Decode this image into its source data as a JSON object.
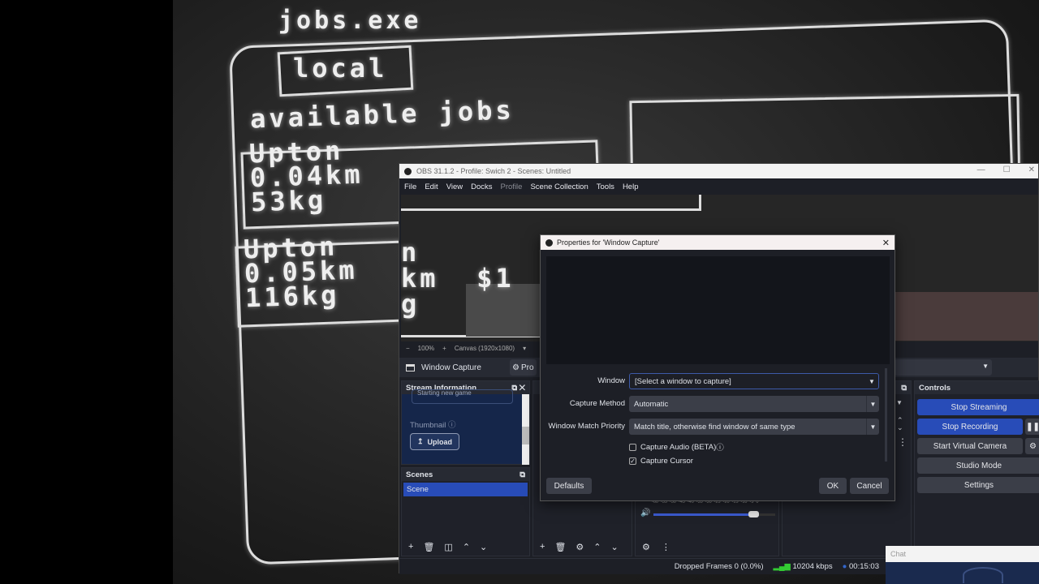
{
  "game": {
    "title": "jobs.exe",
    "tab": "local",
    "heading": "available jobs",
    "jobs": [
      {
        "name": "Upton",
        "distance": "0.04km",
        "weight": "53kg"
      },
      {
        "name": "Upton",
        "distance": "0.05km",
        "weight": "116kg"
      }
    ]
  },
  "obs": {
    "title": "OBS 31.1.2 - Profile: Swich 2 - Scenes: Untitled",
    "menu": [
      "File",
      "Edit",
      "View",
      "Docks",
      "Profile",
      "Scene Collection",
      "Tools",
      "Help"
    ],
    "zoom": {
      "level": "100%",
      "canvas": "Canvas (1920x1080)"
    },
    "source": {
      "name": "Window Capture",
      "properties_label": "Pro"
    },
    "stream_info": {
      "title": "Stream Information",
      "game_field": "Starting new game",
      "thumbnail_label": "Thumbnail",
      "upload_label": "Upload"
    },
    "scenes": {
      "title": "Scenes",
      "items": [
        "Scene"
      ]
    },
    "mixer": {
      "ticks": [
        "-60",
        "-55",
        "-50",
        "-45",
        "-40",
        "-35",
        "-30",
        "-25",
        "-20",
        "-15",
        "-10",
        "-5",
        "0"
      ],
      "volume": 0.82
    },
    "controls": {
      "title": "Controls",
      "stop_streaming": "Stop Streaming",
      "stop_recording": "Stop Recording",
      "start_virtual_camera": "Start Virtual Camera",
      "studio_mode": "Studio Mode",
      "settings": "Settings"
    },
    "status": {
      "dropped_frames": "Dropped Frames 0 (0.0%)",
      "bitrate": "10204 kbps",
      "time": "00:15:03"
    }
  },
  "dialog": {
    "title": "Properties for 'Window Capture'",
    "window_label": "Window",
    "window_value": "[Select a window to capture]",
    "method_label": "Capture Method",
    "method_value": "Automatic",
    "priority_label": "Window Match Priority",
    "priority_value": "Match title, otherwise find window of same type",
    "capture_audio": {
      "label": "Capture Audio (BETA)",
      "checked": false
    },
    "capture_cursor": {
      "label": "Capture Cursor",
      "checked": true
    },
    "defaults": "Defaults",
    "ok": "OK",
    "cancel": "Cancel"
  },
  "chat": {
    "title": "Chat"
  }
}
